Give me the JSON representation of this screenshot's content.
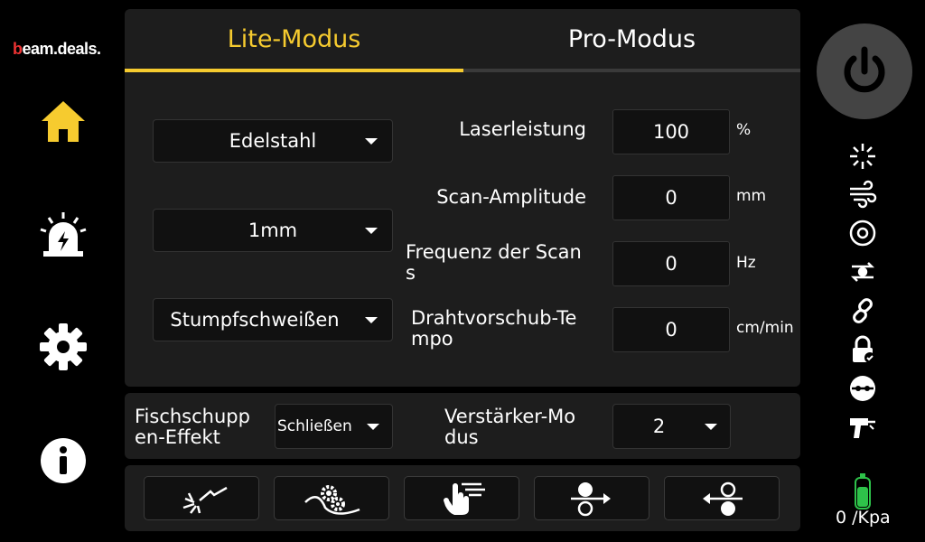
{
  "brand": {
    "logo_b": "b",
    "logo_rest": "eam.deals."
  },
  "tabs": {
    "lite": "Lite-Modus",
    "pro": "Pro-Modus"
  },
  "dropdowns": {
    "material": "Edelstahl",
    "thickness": "1mm",
    "weld_type": "Stumpfschweißen"
  },
  "params": {
    "laser_power": {
      "label": "Laserleistung",
      "value": "100",
      "unit": "%"
    },
    "scan_amplitude": {
      "label": "Scan-Amplitude",
      "value": "0",
      "unit": "mm"
    },
    "scan_frequency": {
      "label_1": "Frequenz der Scan",
      "label_2": "s",
      "value": "0",
      "unit": "Hz"
    },
    "wire_feed": {
      "label_1": "Drahtvorschub-Te",
      "label_2": "mpo",
      "value": "0",
      "unit": "cm/min"
    }
  },
  "fish_scale": {
    "label_1": "Fischschupp",
    "label_2": "en-Effekt",
    "value": "Schließen"
  },
  "amplifier": {
    "label_1": "Verstärker-Mo",
    "label_2": "dus",
    "value": "2"
  },
  "pressure": {
    "text": "0 /Kpa"
  },
  "colors": {
    "accent": "#f6cb2f",
    "brand_red": "#e33",
    "gas_green": "#2ec24a"
  }
}
